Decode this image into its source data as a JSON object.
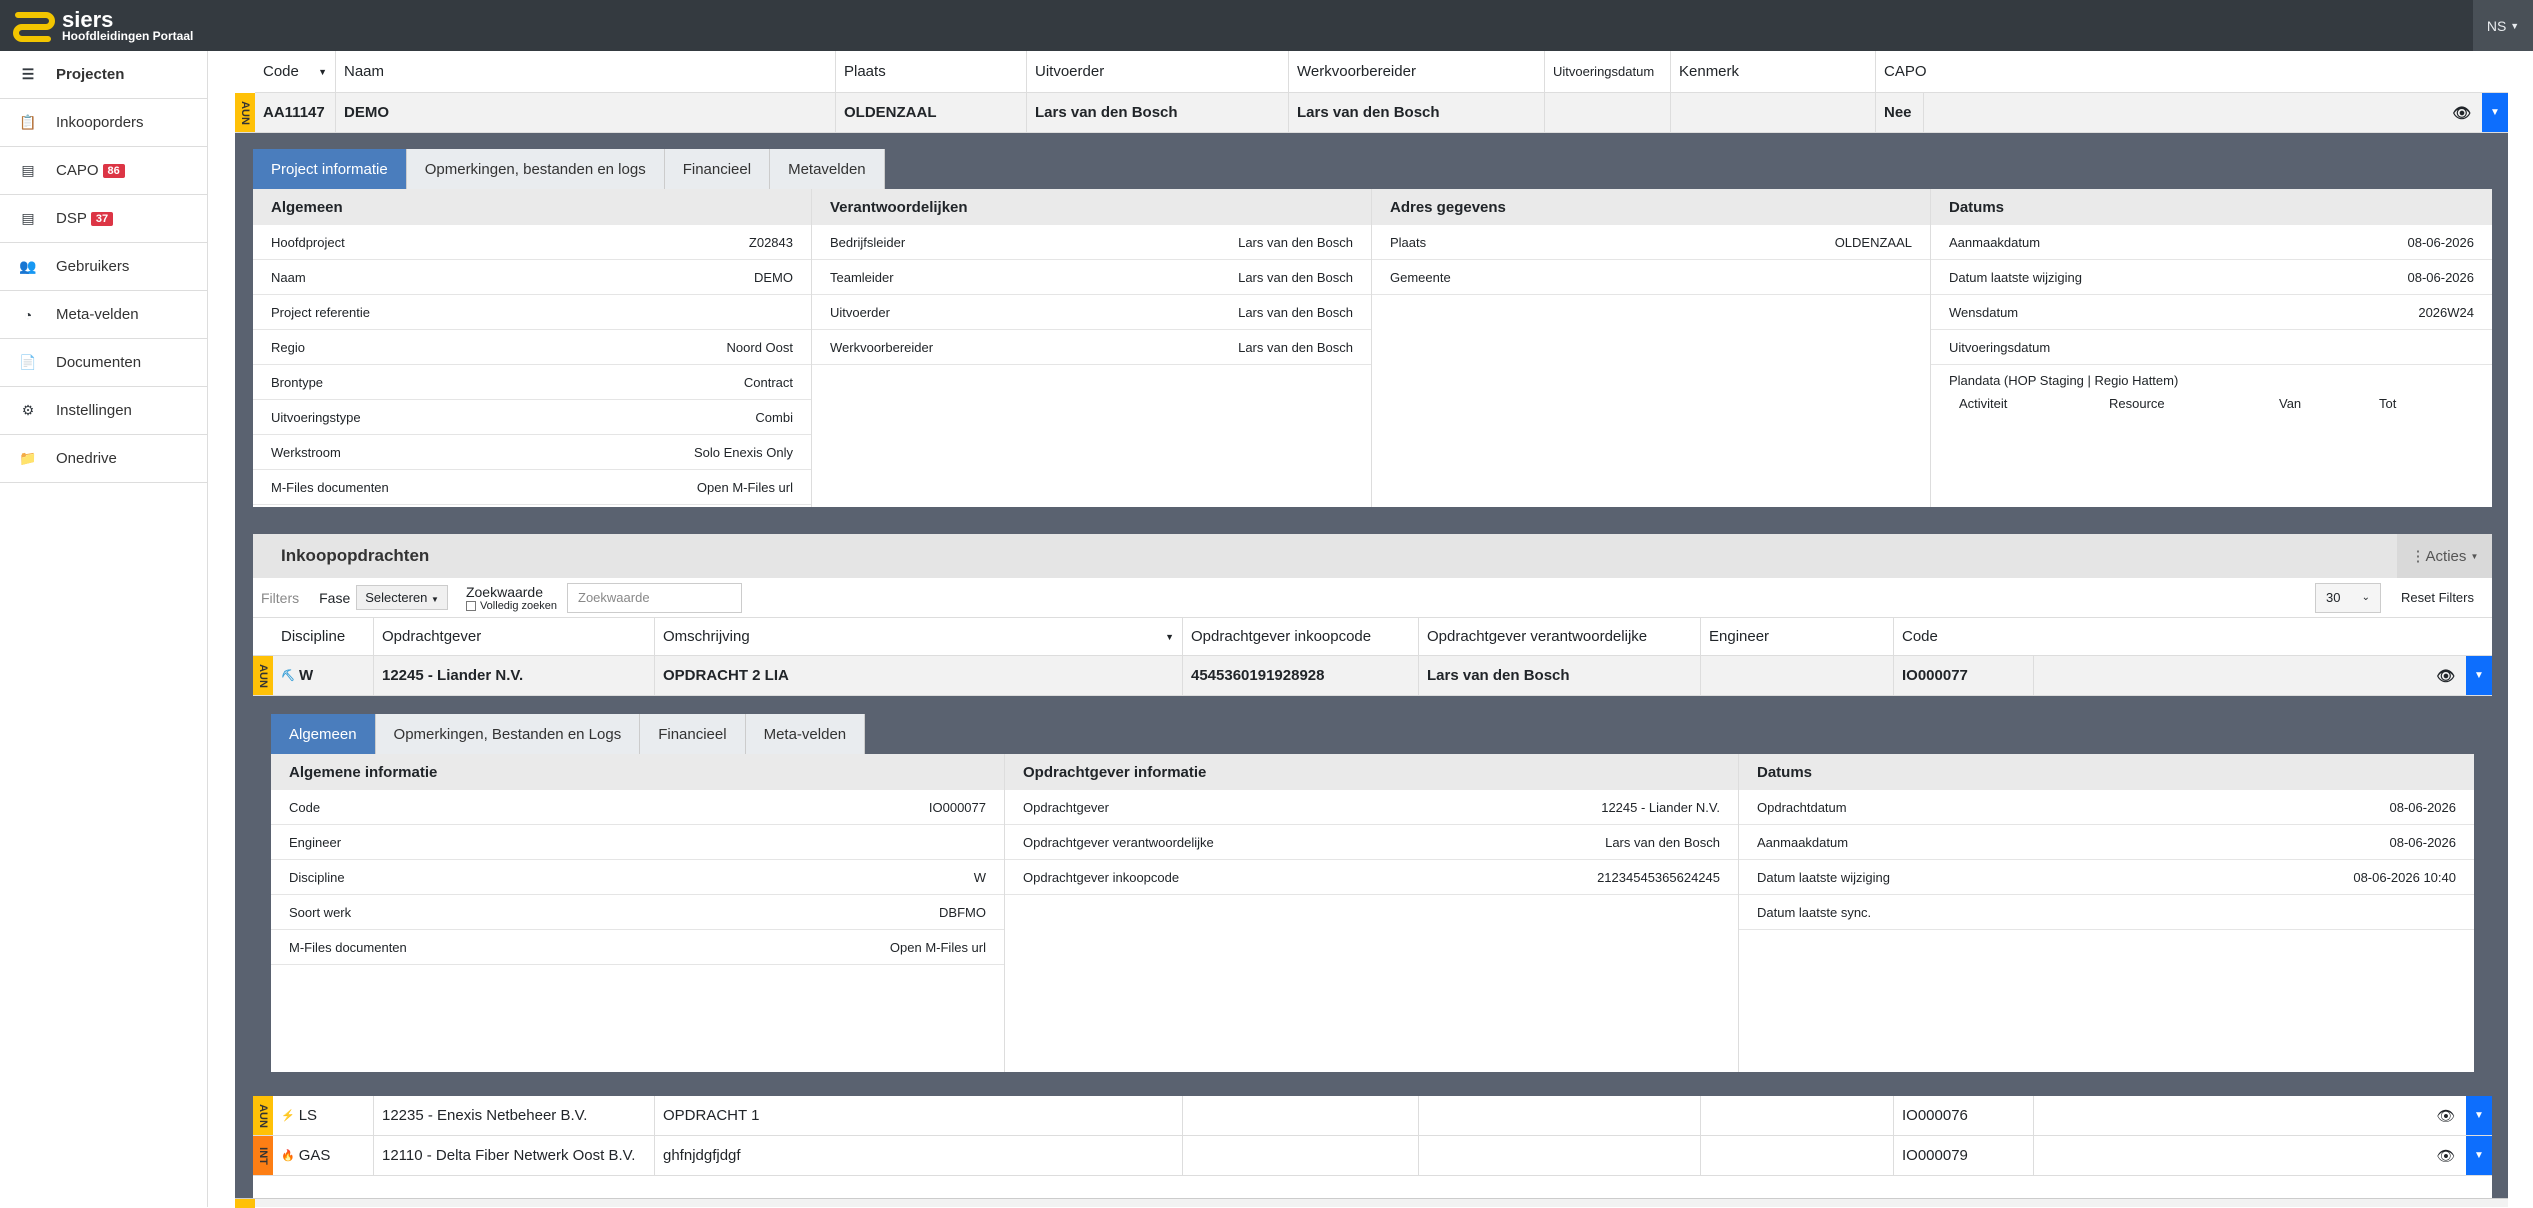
{
  "brand": {
    "name": "siers",
    "subtitle": "Hoofdleidingen Portaal",
    "user": "NS"
  },
  "sidebar": [
    {
      "label": "Projecten",
      "icon": "list-icon",
      "badge": ""
    },
    {
      "label": "Inkooporders",
      "icon": "clipboard-icon",
      "badge": ""
    },
    {
      "label": "CAPO",
      "icon": "table-icon",
      "badge": "86"
    },
    {
      "label": "DSP",
      "icon": "table-icon",
      "badge": "37"
    },
    {
      "label": "Gebruikers",
      "icon": "users-icon",
      "badge": ""
    },
    {
      "label": "Meta-velden",
      "icon": "gauge-icon",
      "badge": ""
    },
    {
      "label": "Documenten",
      "icon": "file-icon",
      "badge": ""
    },
    {
      "label": "Instellingen",
      "icon": "cogs-icon",
      "badge": ""
    },
    {
      "label": "Onedrive",
      "icon": "folder-icon",
      "badge": ""
    }
  ],
  "project_table": {
    "headers": [
      "Code",
      "Naam",
      "Plaats",
      "Uitvoerder",
      "Werkvoorbereider",
      "Uitvoeringsdatum",
      "Kenmerk",
      "CAPO"
    ],
    "row": {
      "tag": "AUN",
      "code": "AA11147",
      "naam": "DEMO",
      "plaats": "OLDENZAAL",
      "uitvoerder": "Lars van den Bosch",
      "werkvoorbereider": "Lars van den Bosch",
      "uitvoeringsdatum": "",
      "kenmerk": "",
      "capo": "Nee"
    }
  },
  "project_tabs": [
    "Project informatie",
    "Opmerkingen, bestanden en logs",
    "Financieel",
    "Metavelden"
  ],
  "algemeen": {
    "title": "Algemeen",
    "rows": [
      [
        "Hoofdproject",
        "Z02843"
      ],
      [
        "Naam",
        "DEMO"
      ],
      [
        "Project referentie",
        ""
      ],
      [
        "Regio",
        "Noord Oost"
      ],
      [
        "Brontype",
        "Contract"
      ],
      [
        "Uitvoeringstype",
        "Combi"
      ],
      [
        "Werkstroom",
        "Solo Enexis Only"
      ],
      [
        "M-Files documenten",
        "Open M-Files url"
      ]
    ]
  },
  "verantwoordelijken": {
    "title": "Verantwoordelijken",
    "rows": [
      [
        "Bedrijfsleider",
        "Lars van den Bosch"
      ],
      [
        "Teamleider",
        "Lars van den Bosch"
      ],
      [
        "Uitvoerder",
        "Lars van den Bosch"
      ],
      [
        "Werkvoorbereider",
        "Lars van den Bosch"
      ]
    ]
  },
  "adres": {
    "title": "Adres gegevens",
    "rows": [
      [
        "Plaats",
        "OLDENZAAL"
      ],
      [
        "Gemeente",
        ""
      ]
    ]
  },
  "datums": {
    "title": "Datums",
    "rows": [
      [
        "Aanmaakdatum",
        "08-06-2026"
      ],
      [
        "Datum laatste wijziging",
        "08-06-2026"
      ],
      [
        "Wensdatum",
        "2026W24"
      ],
      [
        "Uitvoeringsdatum",
        ""
      ]
    ],
    "plandata_label": "Plandata (HOP Staging | Regio Hattem)",
    "plandata_cols": [
      "Activiteit",
      "Resource",
      "Van",
      "Tot"
    ]
  },
  "inkoop": {
    "title": "Inkoopopdrachten",
    "acties": "Acties",
    "filters_label": "Filters",
    "fase_label": "Fase",
    "fase_value": "Selecteren",
    "zoek_label": "Zoekwaarde",
    "volledig": "Volledig zoeken",
    "zoek_placeholder": "Zoekwaarde",
    "page_size": "30",
    "reset": "Reset Filters",
    "headers": [
      "Discipline",
      "Opdrachtgever",
      "Omschrijving",
      "Opdrachtgever inkoopcode",
      "Opdrachtgever verantwoordelijke",
      "Engineer",
      "Code"
    ],
    "rows": [
      {
        "tag": "AUN",
        "disc": "W",
        "og": "12245 - Liander N.V.",
        "oms": "OPDRACHT 2 LIA",
        "ink": "4545360191928928",
        "ver": "Lars van den Bosch",
        "eng": "",
        "code": "IO000077"
      },
      {
        "tag": "AUN",
        "disc": "LS",
        "og": "12235 - Enexis Netbeheer B.V.",
        "oms": "OPDRACHT 1",
        "ink": "",
        "ver": "",
        "eng": "",
        "code": "IO000076"
      },
      {
        "tag": "INT",
        "disc": "GAS",
        "og": "12110 - Delta Fiber Netwerk Oost B.V.",
        "oms": "ghfnjdgfjdgf",
        "ink": "",
        "ver": "",
        "eng": "",
        "code": "IO000079"
      }
    ]
  },
  "order_tabs": [
    "Algemeen",
    "Opmerkingen, Bestanden en Logs",
    "Financieel",
    "Meta-velden"
  ],
  "order_alg": {
    "title": "Algemene informatie",
    "rows": [
      [
        "Code",
        "IO000077"
      ],
      [
        "Engineer",
        ""
      ],
      [
        "Discipline",
        "W"
      ],
      [
        "Soort werk",
        "DBFMO"
      ],
      [
        "M-Files documenten",
        "Open M-Files url"
      ]
    ]
  },
  "order_og": {
    "title": "Opdrachtgever informatie",
    "rows": [
      [
        "Opdrachtgever",
        "12245 - Liander N.V."
      ],
      [
        "Opdrachtgever verantwoordelijke",
        "Lars van den Bosch"
      ],
      [
        "Opdrachtgever inkoopcode",
        "21234545365624245"
      ]
    ]
  },
  "order_dat": {
    "title": "Datums",
    "rows": [
      [
        "Opdrachtdatum",
        "08-06-2026"
      ],
      [
        "Aanmaakdatum",
        "08-06-2026"
      ],
      [
        "Datum laatste wijziging",
        "08-06-2026 10:40"
      ],
      [
        "Datum laatste sync.",
        ""
      ]
    ]
  },
  "colors": {
    "accent": "#4a7dbd",
    "primary": "#0d6efd",
    "tag_aun": "#ffc107",
    "tag_int": "#fd7e14",
    "badge": "#dc3545"
  }
}
